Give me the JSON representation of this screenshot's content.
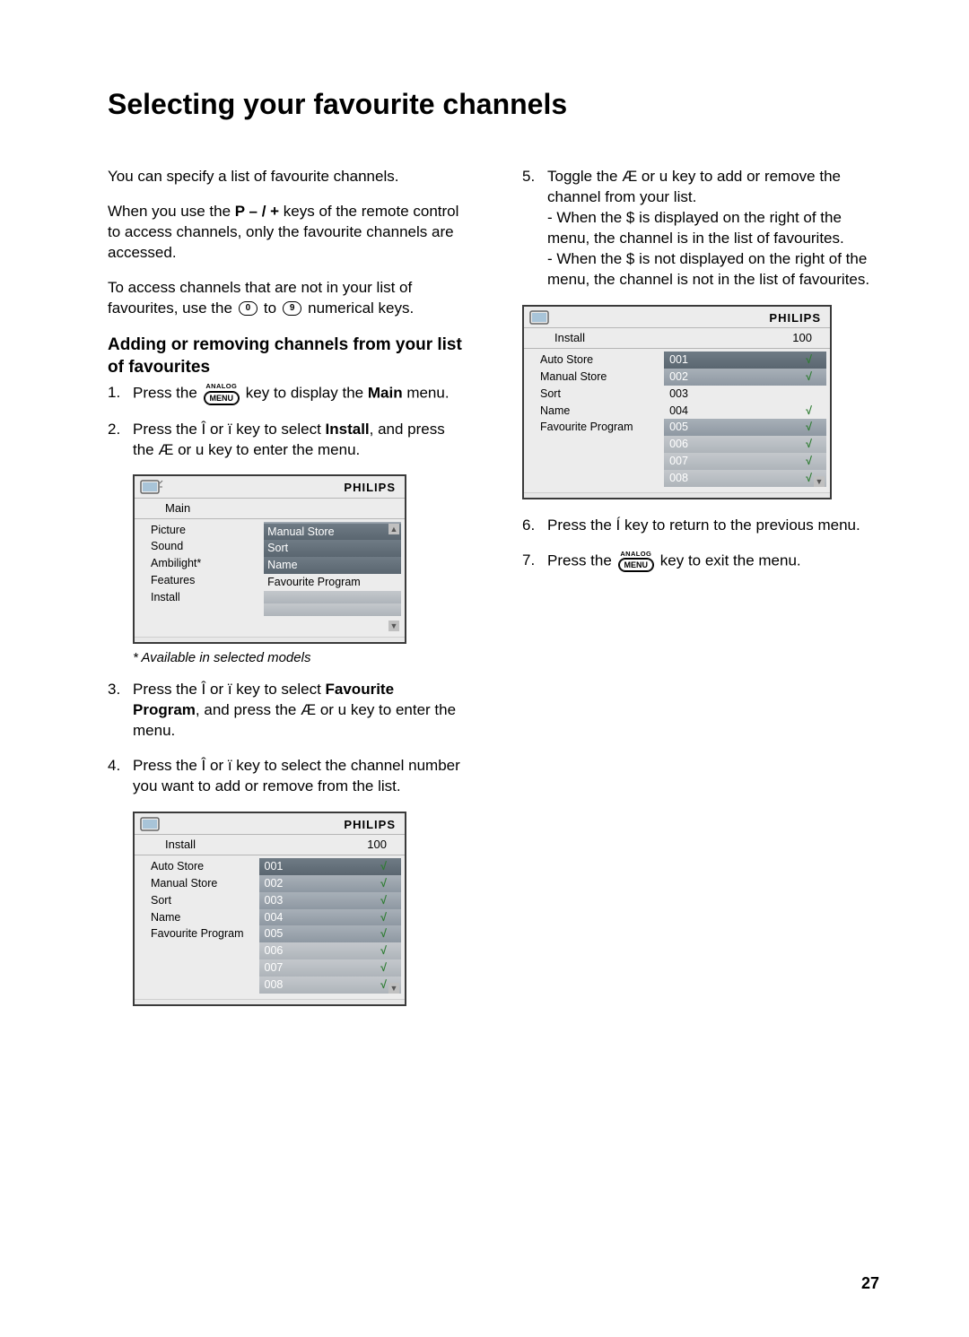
{
  "title": "Selecting your favourite channels",
  "page_number": "27",
  "intro": {
    "p1": "You can specify a list of favourite channels.",
    "p2a": "When you use the ",
    "p2b": "P – / +",
    "p2c": " keys of the remote control to access channels, only the favourite channels are accessed.",
    "p3a": "To access channels that are not in your list of favourites, use the ",
    "p3b": " to ",
    "p3c": " numerical keys."
  },
  "subhead": "Adding or removing channels from your list of favourites",
  "key_menu": "MENU",
  "key_analog": "ANALOG",
  "key0": "0",
  "key9": "9",
  "steps": {
    "s1a": "Press the ",
    "s1b": " key to display the ",
    "s1c": "Main",
    "s1d": " menu.",
    "s2a": "Press the ",
    "s2b": "Î",
    "s2c": " or ",
    "s2d": "ï",
    "s2e": " key to select ",
    "s2f": "Install",
    "s2g": ", and press the ",
    "s2h": "Æ",
    "s2i": " or ",
    "s2j": "u",
    "s2k": " key to enter the menu.",
    "s3a": "Press the ",
    "s3b": "Î",
    "s3c": " or ",
    "s3d": "ï",
    "s3e": " key to select ",
    "s3f": "Favourite Program",
    "s3g": ", and press the ",
    "s3h": "Æ",
    "s3i": " or ",
    "s3j": "u",
    "s3k": " key to enter the menu.",
    "s4a": "Press the ",
    "s4b": "Î",
    "s4c": " or ",
    "s4d": "ï",
    "s4e": " key to select the channel number you want to add or remove from the list.",
    "s5a": "Toggle the ",
    "s5b": "Æ",
    "s5c": " or ",
    "s5d": "u",
    "s5e": " key to add or remove the channel from your list.",
    "s5f": "- When the ",
    "s5g": "$",
    "s5h": " is displayed on the right of the menu, the channel is in the list of favourites.",
    "s5i": "- When the ",
    "s5j": "$",
    "s5k": " is not displayed on the right of the menu, the channel is not in the list of favourites.",
    "s6a": "Press the ",
    "s6b": "Í",
    "s6c": " key to return to the previous menu.",
    "s7a": "Press the ",
    "s7b": " key to exit the menu."
  },
  "footnote": "* Available in selected models",
  "brand": "PHILIPS",
  "menu1": {
    "title": "Main",
    "left": [
      "Picture",
      "Sound",
      "Ambilight*",
      "Features",
      "Install"
    ],
    "right": [
      "",
      "Manual Store",
      "Sort",
      "Name",
      "Favourite Program"
    ]
  },
  "menu2": {
    "title": "Install",
    "title_right": "100",
    "left": [
      "Auto Store",
      "Manual Store",
      "Sort",
      "Name",
      "Favourite Program"
    ],
    "rows": [
      {
        "num": "001",
        "chk": true
      },
      {
        "num": "002",
        "chk": true
      },
      {
        "num": "003",
        "chk": true
      },
      {
        "num": "004",
        "chk": true
      },
      {
        "num": "005",
        "chk": true
      },
      {
        "num": "006",
        "chk": true
      },
      {
        "num": "007",
        "chk": true
      },
      {
        "num": "008",
        "chk": true
      }
    ]
  },
  "menu3": {
    "title": "Install",
    "title_right": "100",
    "left": [
      "Auto Store",
      "Manual Store",
      "Sort",
      "Name",
      "Favourite Program"
    ],
    "rows": [
      {
        "num": "001",
        "chk": true
      },
      {
        "num": "002",
        "chk": true
      },
      {
        "num": "003",
        "chk": false
      },
      {
        "num": "004",
        "chk": true
      },
      {
        "num": "005",
        "chk": true
      },
      {
        "num": "006",
        "chk": true
      },
      {
        "num": "007",
        "chk": true
      },
      {
        "num": "008",
        "chk": true
      }
    ]
  }
}
